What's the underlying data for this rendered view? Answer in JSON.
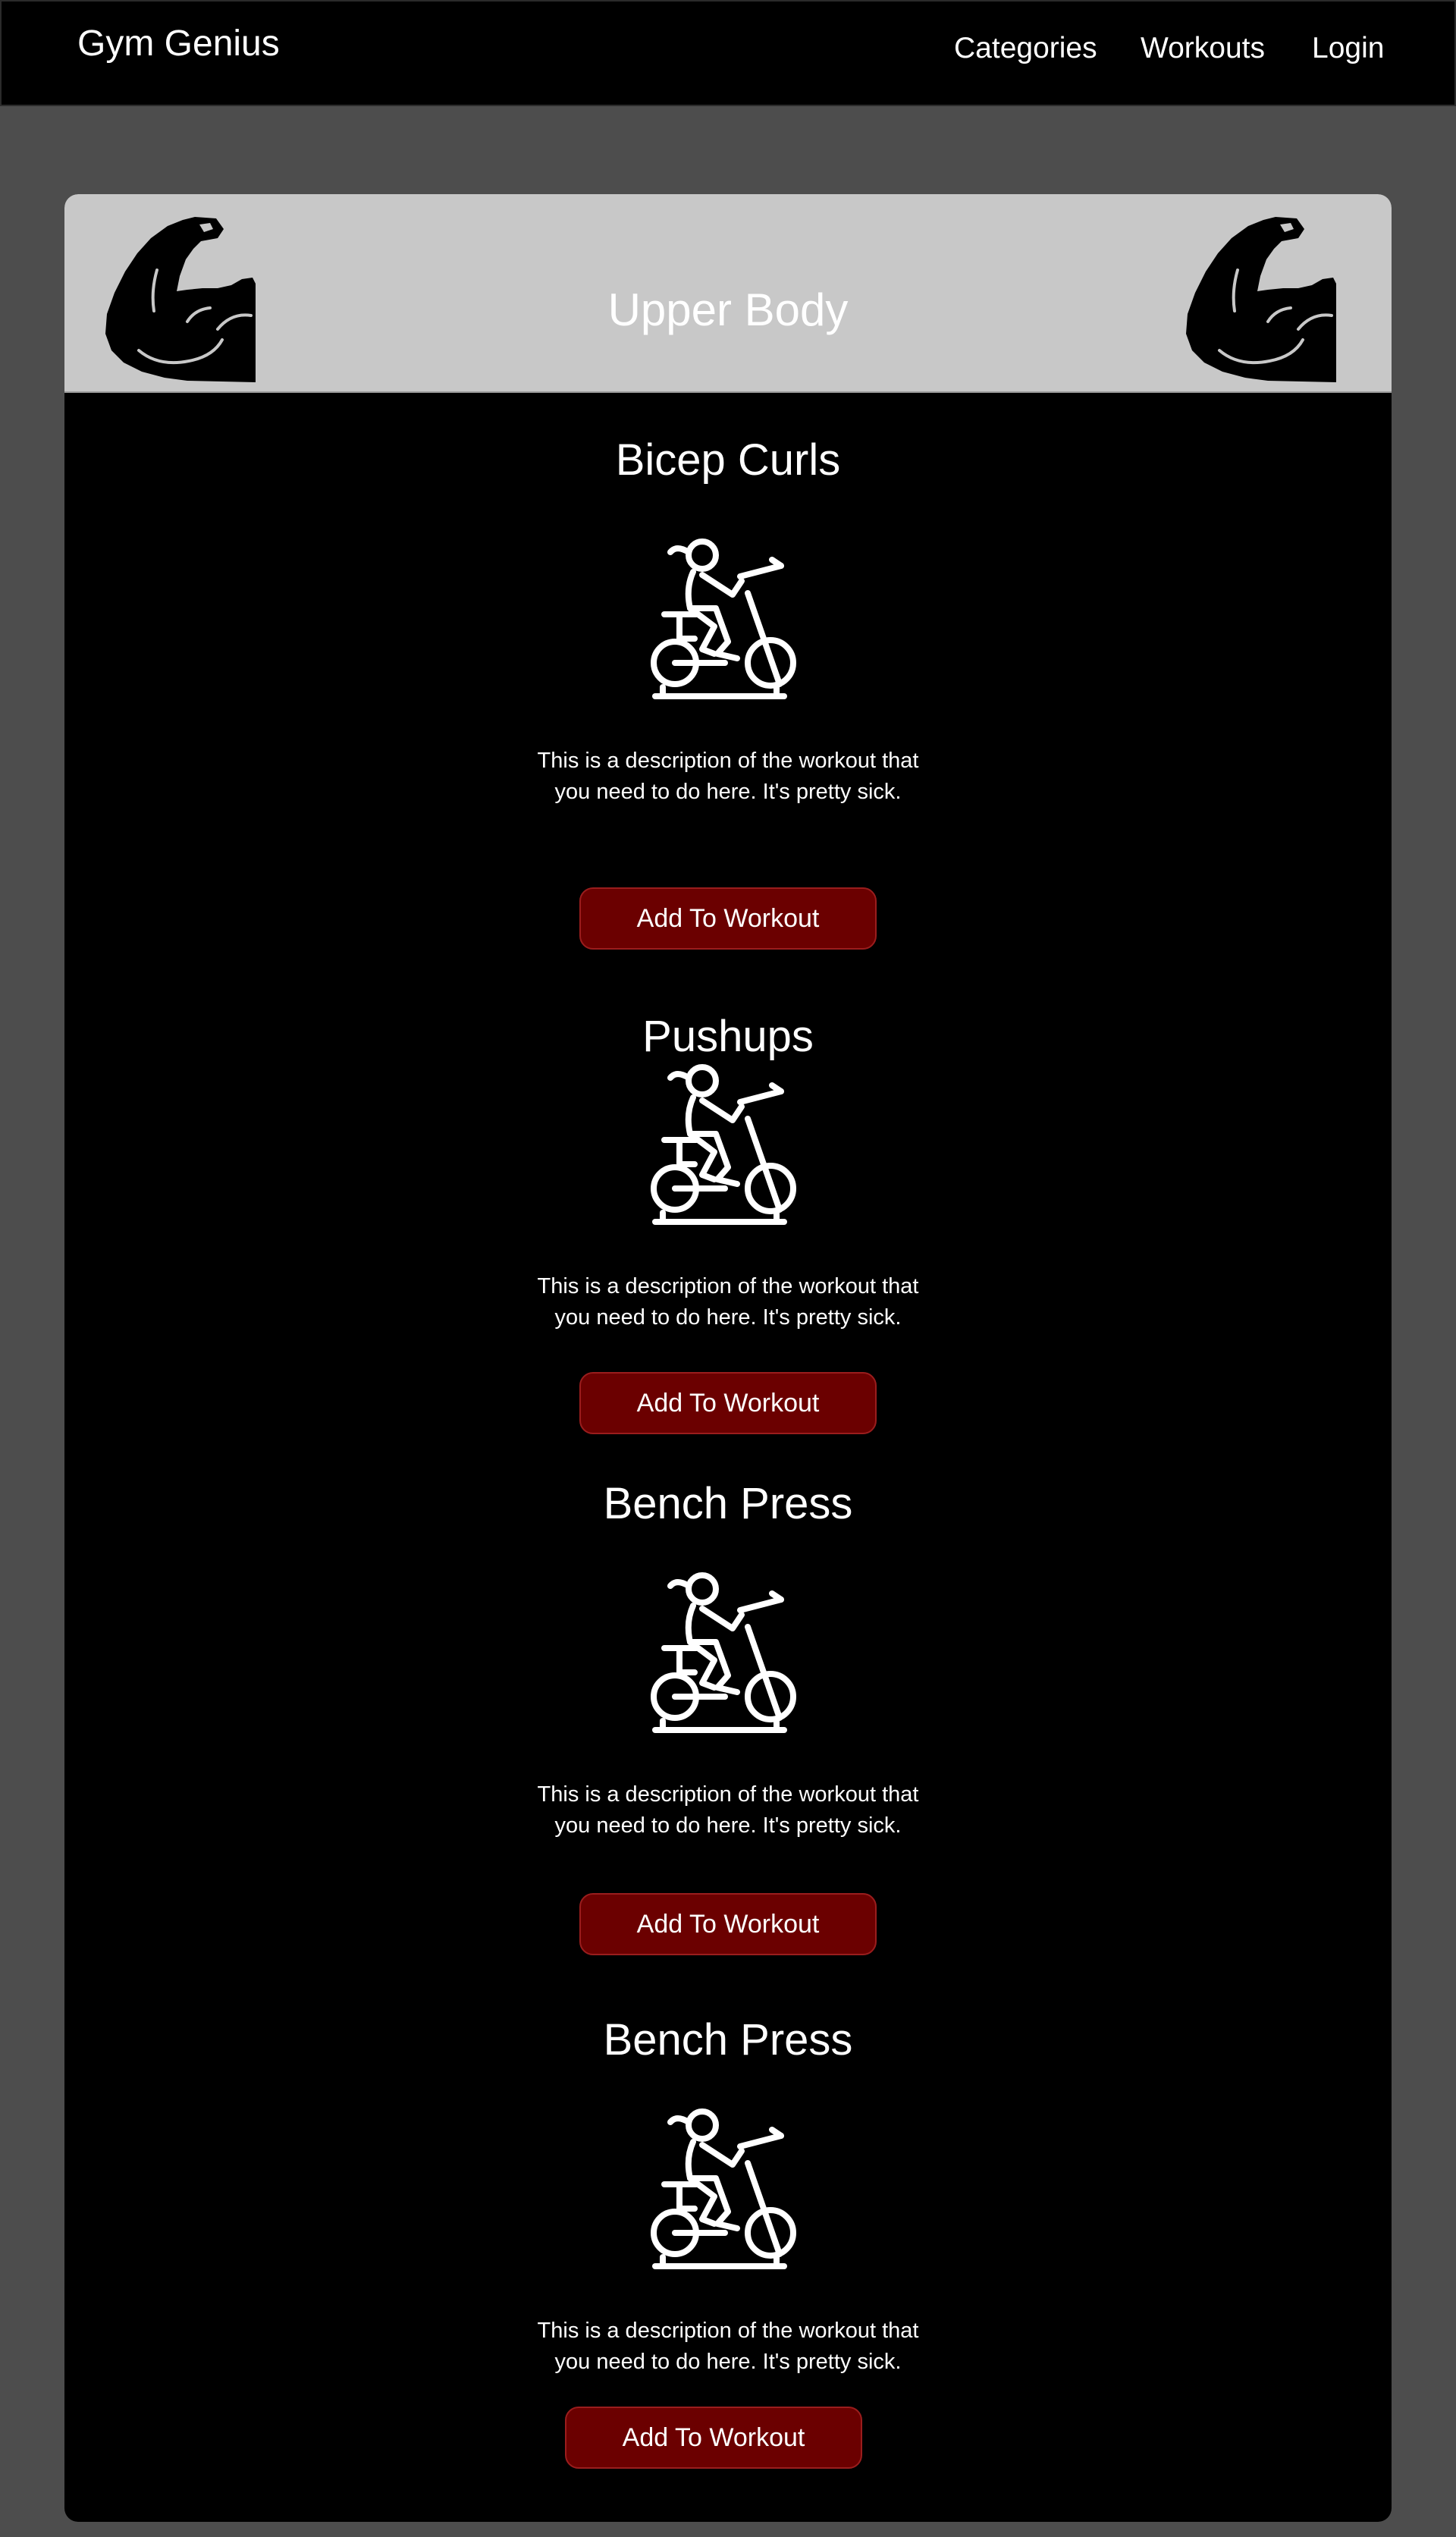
{
  "navbar": {
    "brand": "Gym Genius",
    "links": [
      "Categories",
      "Workouts",
      "Login"
    ]
  },
  "category": {
    "title": "Upper Body",
    "header_icon": "flexed-arm-icon",
    "header_bg": "#c8c8c8"
  },
  "workouts": [
    {
      "title": "Bicep Curls",
      "icon": "exercise-bike-icon",
      "description_lines": [
        "This is a description of the workout that",
        "you need to do here. It's pretty sick."
      ],
      "button_label": "Add To Workout"
    },
    {
      "title": "Pushups",
      "icon": "exercise-bike-icon",
      "description_lines": [
        "This is a description of the workout that",
        "you need to do here. It's pretty sick."
      ],
      "button_label": "Add To Workout"
    },
    {
      "title": "Bench Press",
      "icon": "exercise-bike-icon",
      "description_lines": [
        "This is a description of the workout that",
        "you need to do here. It's pretty sick."
      ],
      "button_label": "Add To Workout"
    },
    {
      "title": "Bench Press",
      "icon": "exercise-bike-icon",
      "description_lines": [
        "This is a description of the workout that",
        "you need to do here. It's pretty sick."
      ],
      "button_label": "Add To Workout"
    }
  ],
  "colors": {
    "page_bg": "#4d4d4d",
    "card_bg": "#000000",
    "button_bg": "#6b0000",
    "text": "#ffffff"
  }
}
